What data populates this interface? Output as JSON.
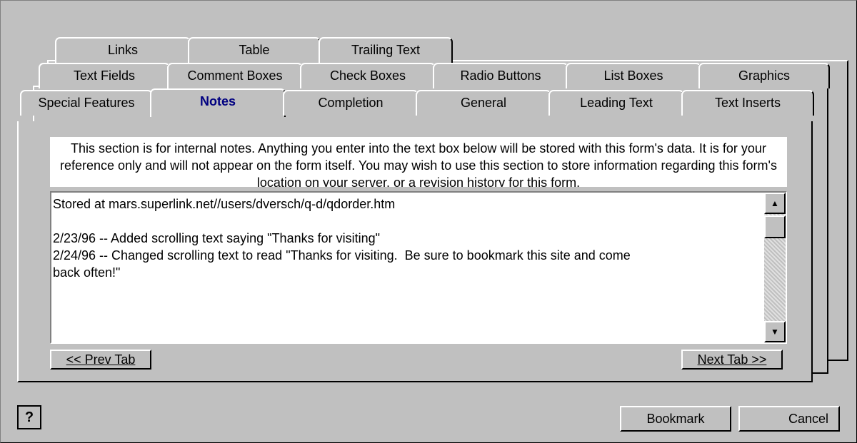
{
  "tabs": {
    "row3": [
      "Links",
      "Table",
      "Trailing Text"
    ],
    "row2": [
      "Text Fields",
      "Comment Boxes",
      "Check Boxes",
      "Radio Buttons",
      "List Boxes",
      "Graphics"
    ],
    "row1": [
      "Special Features",
      "Notes",
      "Completion",
      "General",
      "Leading Text",
      "Text Inserts"
    ],
    "active": "Notes"
  },
  "description": "This section is for internal notes.  Anything you enter into the text box below will be stored with this form's data.  It is for your reference only and will not appear on the form itself.  You may wish to use this section to store information regarding this form's location on your server, or a revision history for this form.",
  "notes": {
    "lines": [
      "Stored at mars.superlink.net//users/dversch/q-d/qdorder.htm",
      "",
      "2/23/96 -- Added scrolling text saying \"Thanks for visiting\"",
      "2/24/96 -- Changed scrolling text to read \"Thanks for visiting.  Be sure to bookmark this site and come",
      "back often!\""
    ]
  },
  "scrollbar": {
    "up_icon": "arrow-up-icon",
    "down_icon": "arrow-down-icon"
  },
  "buttons": {
    "prev_tab": "<< Prev Tab",
    "next_tab": "Next Tab >>",
    "bookmark": "Bookmark",
    "cancel": "Cancel",
    "help_icon": "?"
  }
}
